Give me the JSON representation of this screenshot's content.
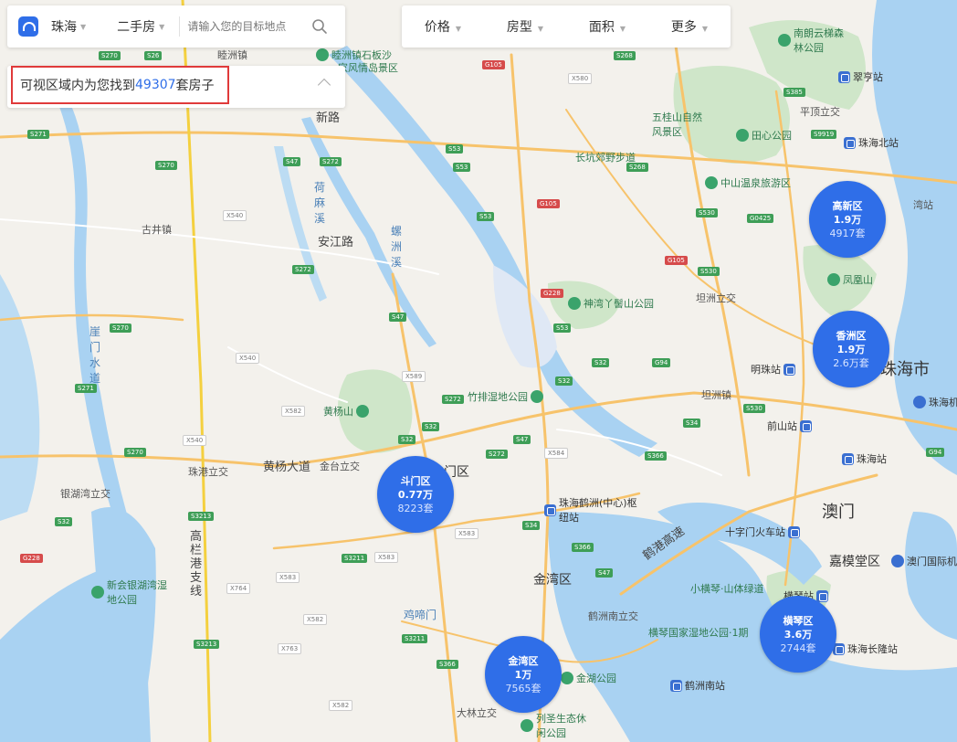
{
  "search": {
    "city": "珠海",
    "kind": "二手房",
    "placeholder": "请输入您的目标地点"
  },
  "result": {
    "prefix": "可视区域内为您找到",
    "count": "49307",
    "suffix": "套房子"
  },
  "filters": [
    "价格",
    "房型",
    "面积",
    "更多"
  ],
  "districts": [
    {
      "name": "高新区",
      "price": "1.9万",
      "count": "4917套"
    },
    {
      "name": "香洲区",
      "price": "1.9万",
      "count": "2.6万套"
    },
    {
      "name": "斗门区",
      "price": "0.77万",
      "count": "8223套"
    },
    {
      "name": "金湾区",
      "price": "1万",
      "count": "7565套"
    },
    {
      "name": "横琴区",
      "price": "3.6万",
      "count": "2744套"
    }
  ],
  "map_labels": {
    "chengzhen": "睦洲镇",
    "linzhou": "睦洲镇石板沙",
    "linzhou2": "家风情岛景区",
    "gujing": "古井镇",
    "yamen": "崖门水道",
    "heshaxi": "荷麻溪",
    "anjiang": "安江路",
    "luozhou": "螺洲溪",
    "huangyangshan": "黄杨山",
    "huangyangdadao": "黄杨大道",
    "jintai": "金台立交",
    "zhugang": "珠港立交",
    "yinhuwan": "银湖湾立交",
    "gaolan": "高栏港支线",
    "xinhui": "新会银湖湾湿地公园",
    "jimen": "鸡啼门",
    "jinwanqu": "金湾区",
    "doumenqu_lbl": "门区",
    "helunan": "鹤洲南立交",
    "hegang": "鹤港高速",
    "hengqin": "横琴国家湿地公园·1期",
    "xiaohengqin": "小横琴·山体绿道",
    "jinhu": "金湖公园",
    "liesheng": "列圣生态休闲公园",
    "dalin": "大林立交",
    "shenwan": "神湾丫髻山公园",
    "zhupai": "竹排湿地公园",
    "wuguishan": "五桂山自然风景区",
    "tianxin": "田心公园",
    "changkeng": "长坑郊野步道",
    "zhongshan": "中山温泉旅游区",
    "tanzhou": "坦洲立交",
    "tanzhouzhen": "坦洲镇",
    "pingding": "平顶立交",
    "nanlang": "南朗云梯森林公园",
    "fenghuang": "凤凰山",
    "zhuhai_city": "珠海市",
    "macau": "澳门",
    "jiamotang": "嘉模堂区",
    "shizimen": "十字门火车站",
    "mingzhu": "明珠站",
    "qianshan": "前山站",
    "zhuhaizhan": "珠海站",
    "cuiheng": "翠亨站",
    "zhuhaibei": "珠海北站",
    "hezhou_hub": "珠海鹤洲(中心)枢纽站",
    "hezhounan": "鹤洲南站",
    "changlong": "珠海长隆站",
    "hengqinzhan": "横琴站",
    "airport1": "珠海机",
    "airport2": "澳门国际机",
    "wanzhan": "湾站",
    "xinlu": "新路"
  }
}
